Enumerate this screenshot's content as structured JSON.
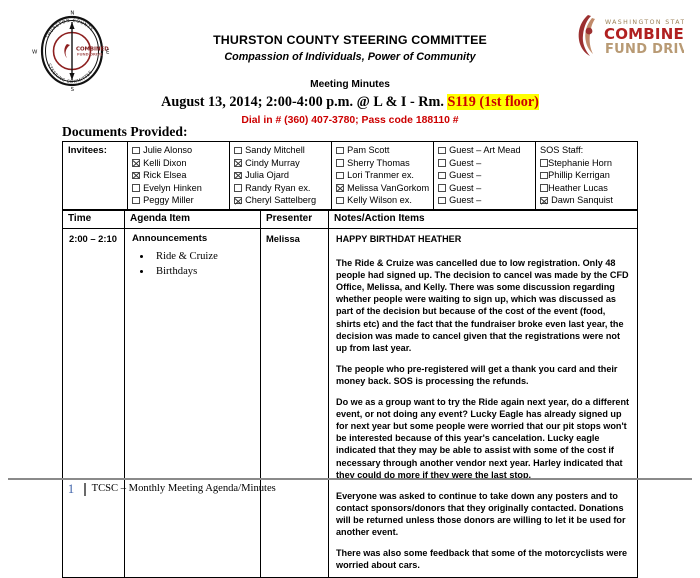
{
  "header": {
    "org_title": "THURSTON COUNTY STEERING COMMITTEE",
    "tagline": "Compassion of Individuals, Power of Community",
    "meeting_kind": "Meeting Minutes",
    "meeting_when_prefix": "August 13, 2014; 2:00-4:00 p.m. @ L & I - Rm. ",
    "meeting_room_highlight": "S119 (1st floor)",
    "dial_in": "Dial in # (360) 407-3780; Pass code 188110 #",
    "left_seal": {
      "outer_text_top": "THURSTON COUNTY",
      "outer_text_bottom": "STEERING COMMITTEE",
      "inner_line1": "COMBINED",
      "inner_line2": "FUND DRIVE",
      "compass_n": "N",
      "compass_s": "S",
      "compass_e": "E",
      "compass_w": "W"
    },
    "right_logo": {
      "line1": "WASHINGTON STATE",
      "line2": "COMBINED",
      "line3": "FUND DRIVE",
      "red": "#b02020",
      "tan": "#b89a74"
    }
  },
  "documents_provided_label": "Documents Provided:",
  "invitees": {
    "label": "Invitees:",
    "columns": [
      {
        "header": null,
        "items": [
          {
            "label": "Julie Alonso",
            "checked": false
          },
          {
            "label": "Kelli Dixon",
            "checked": true
          },
          {
            "label": "Rick Elsea",
            "checked": true
          },
          {
            "label": "Evelyn Hinken",
            "checked": false
          },
          {
            "label": "Peggy Miller",
            "checked": false
          }
        ]
      },
      {
        "header": null,
        "items": [
          {
            "label": "Sandy Mitchell",
            "checked": false
          },
          {
            "label": "Cindy Murray",
            "checked": true
          },
          {
            "label": "Julia Ojard",
            "checked": true
          },
          {
            "label": "Randy Ryan ex.",
            "checked": false
          },
          {
            "label": "Cheryl Sattelberg",
            "checked": true
          }
        ]
      },
      {
        "header": null,
        "items": [
          {
            "label": "Pam Scott",
            "checked": false
          },
          {
            "label": "Sherry Thomas",
            "checked": false
          },
          {
            "label": "Lori Tranmer ex.",
            "checked": false
          },
          {
            "label": "Melissa VanGorkom",
            "checked": true
          },
          {
            "label": "Kelly Wilson ex.",
            "checked": false
          }
        ]
      },
      {
        "header": null,
        "items": [
          {
            "label": "Guest – Art Mead",
            "checked": false
          },
          {
            "label": "Guest –",
            "checked": false
          },
          {
            "label": "Guest –",
            "checked": false
          },
          {
            "label": "Guest –",
            "checked": false
          },
          {
            "label": "Guest –",
            "checked": false
          }
        ]
      },
      {
        "header": "SOS Staff:",
        "items": [
          {
            "label": "Stephanie Horn",
            "checked": false,
            "tight": true
          },
          {
            "label": "Phillip Kerrigan",
            "checked": false,
            "tight": true
          },
          {
            "label": "Heather Lucas",
            "checked": false,
            "tight": true
          },
          {
            "label": "Dawn Sanquist",
            "checked": true,
            "tight": false
          }
        ]
      }
    ]
  },
  "agenda": {
    "headers": {
      "time": "Time",
      "agenda_item": "Agenda Item",
      "presenter": "Presenter",
      "notes": "Notes/Action Items"
    },
    "rows": [
      {
        "time": "2:00 – 2:10",
        "agenda_title": "Announcements",
        "bullets": [
          "Ride & Cruize",
          "Birthdays"
        ],
        "presenter": "Melissa",
        "notes_heading": "HAPPY BIRTHDAT HEATHER",
        "notes_paragraphs": [
          "The Ride & Cruize was cancelled due to low registration. Only 48 people had signed up. The decision to cancel was made by the CFD Office, Melissa, and Kelly. There was some discussion regarding whether people were waiting to sign up, which was discussed as part of the decision but because of the cost of the event (food, shirts etc) and the fact that the fundraiser broke even last year, the decision was made to cancel given that the registrations were not up from last year.",
          "The people who pre-registered will get a thank you card and their money back. SOS is processing the refunds.",
          "Do we as a group want to try the Ride again next year,  do a different event, or not doing any event? Lucky Eagle has already signed up for next year but some people were worried that our pit stops won't be interested because of this year's cancelation.  Lucky eagle indicated that they may be able to assist with some of the cost if necessary through another vendor next year.  Harley indicated that they could do more if they were the last stop.",
          "Everyone was asked to continue to take down any posters and to contact sponsors/donors that they originally contacted.  Donations will be returned unless those donors are willing to let it be used for another event.",
          "There was also some feedback that some of the motorcyclists were worried about cars."
        ]
      }
    ]
  },
  "footer": {
    "page_number": "1",
    "text": "TCSC – Monthly Meeting Agenda/Minutes"
  }
}
